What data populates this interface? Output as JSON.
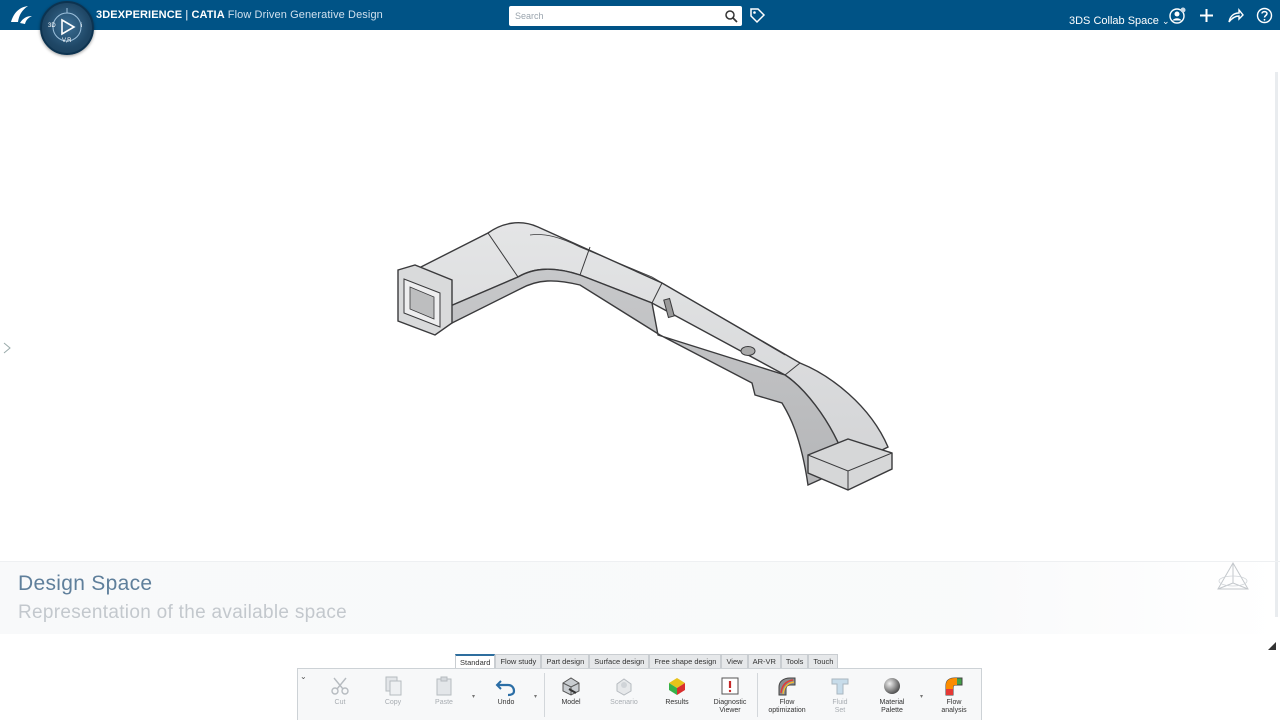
{
  "topbar": {
    "brand": "3DEXPERIENCE",
    "separator": " | ",
    "app": "CATIA",
    "app_subtitle": "Flow Driven Generative Design",
    "search_placeholder": "Search",
    "space": "3DS Collab Space",
    "compass_labels": {
      "left": "3D",
      "right": "i",
      "bottom": "V,R"
    }
  },
  "viewport": {
    "info_title": "Design Space",
    "info_subtitle": "Representation of the available space"
  },
  "action_bar": {
    "tabs": [
      {
        "label": "Standard",
        "active": true
      },
      {
        "label": "Flow study",
        "active": false
      },
      {
        "label": "Part design",
        "active": false
      },
      {
        "label": "Surface design",
        "active": false
      },
      {
        "label": "Free shape design",
        "active": false
      },
      {
        "label": "View",
        "active": false
      },
      {
        "label": "AR-VR",
        "active": false
      },
      {
        "label": "Tools",
        "active": false
      },
      {
        "label": "Touch",
        "active": false
      }
    ],
    "commands": {
      "cut": "Cut",
      "copy": "Copy",
      "paste": "Paste",
      "undo": "Undo",
      "model": "Model",
      "scenario": "Scenario",
      "results": "Results",
      "diagnostic_viewer_1": "Diagnostic",
      "diagnostic_viewer_2": "Viewer",
      "flow_optimization_1": "Flow",
      "flow_optimization_2": "optimization",
      "fluid_set_1": "Fluid",
      "fluid_set_2": "Set",
      "material_palette_1": "Material",
      "material_palette_2": "Palette",
      "flow_analysis_1": "Flow",
      "flow_analysis_2": "analysis"
    }
  },
  "colors": {
    "topbar": "#005386",
    "accent": "#2e6e9e",
    "info_title": "#5f7f9b"
  }
}
